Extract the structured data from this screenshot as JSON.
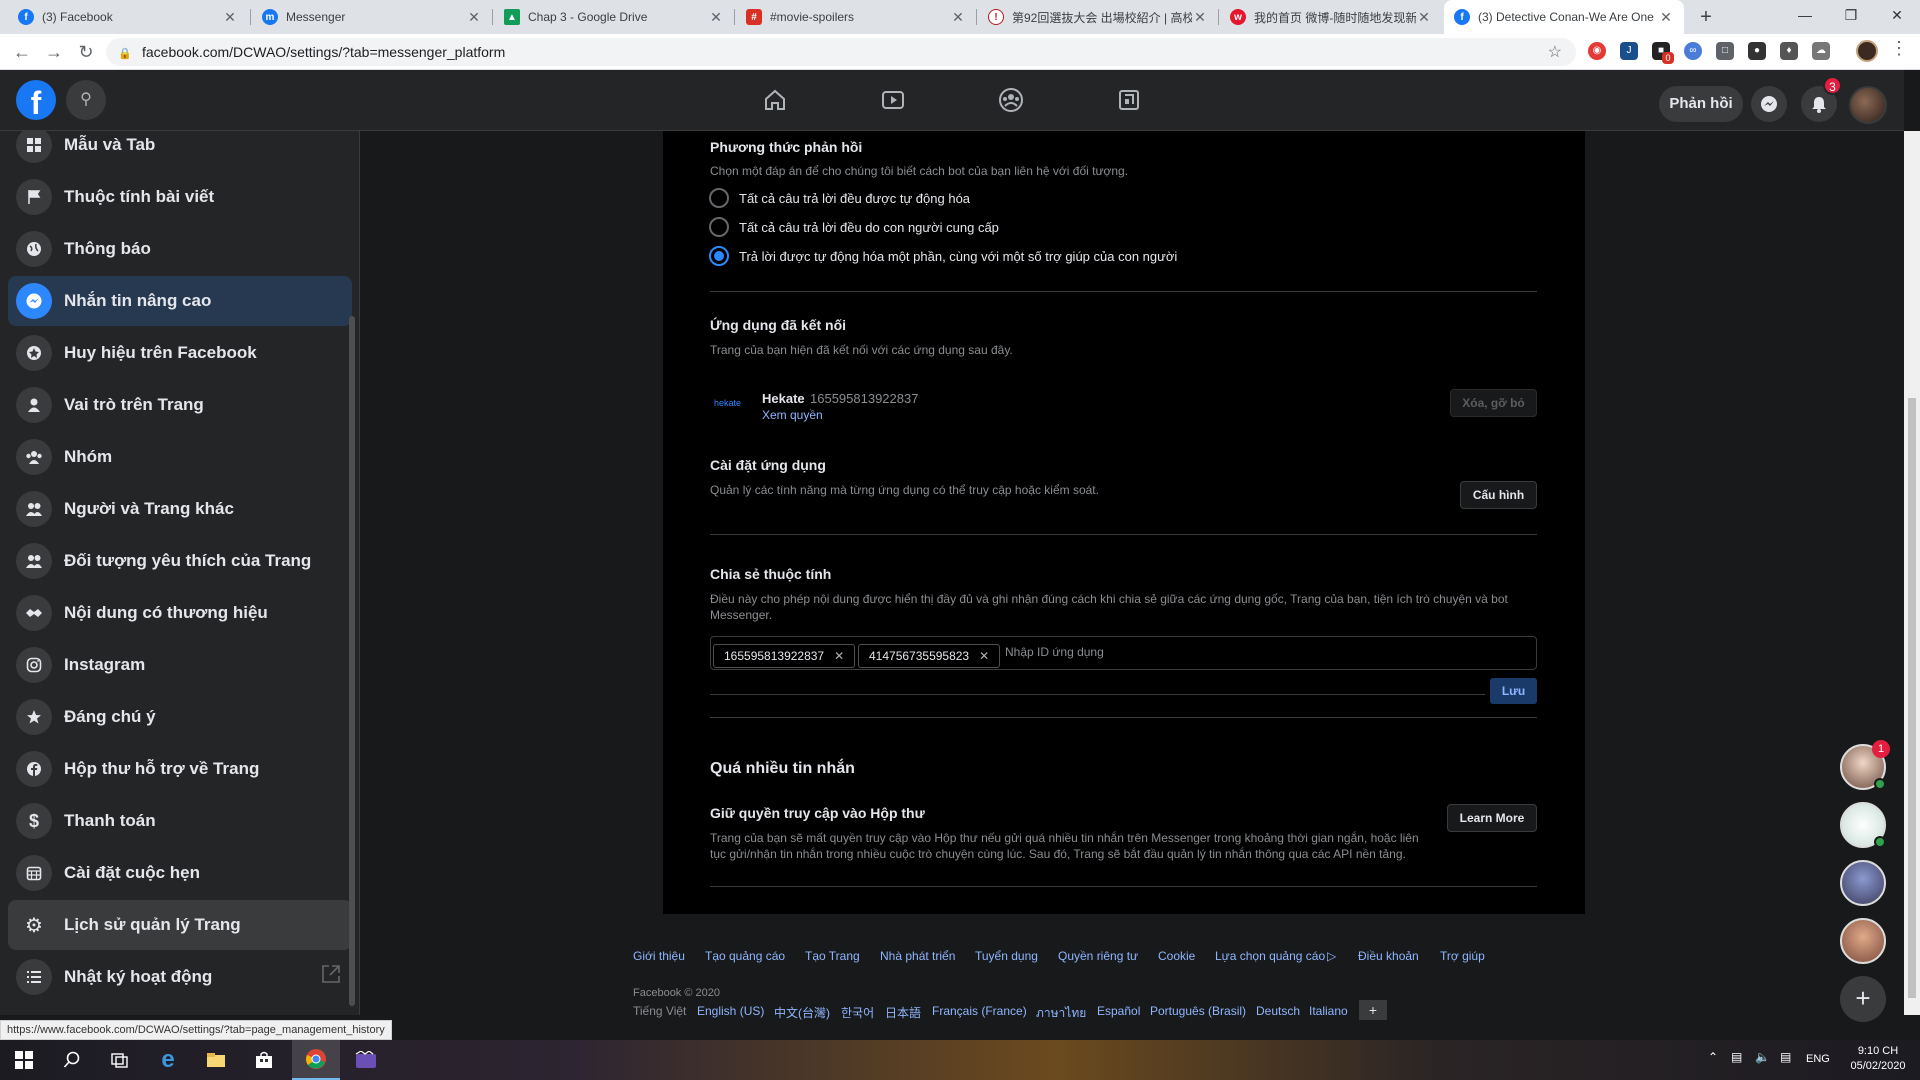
{
  "browser": {
    "tabs": [
      {
        "label": "(3) Facebook",
        "icon": "facebook-icon",
        "color": "#1877f2"
      },
      {
        "label": "Messenger",
        "icon": "messenger-icon",
        "color": "#1877f2"
      },
      {
        "label": "Chap 3 - Google Drive",
        "icon": "google-drive-icon",
        "color": "#0f9d58"
      },
      {
        "label": "#movie-spoilers",
        "icon": "discord-icon",
        "color": "#d93025"
      },
      {
        "label": "第92回選抜大会 出場校紹介 | 高校",
        "icon": "site-icon",
        "color": "#b71c1c"
      },
      {
        "label": "我的首页 微博-随时随地发现新鲜",
        "icon": "weibo-icon",
        "color": "#e6162d"
      },
      {
        "label": "(3) Detective Conan-We Are One",
        "icon": "facebook-icon",
        "color": "#1877f2"
      }
    ],
    "url": "facebook.com/DCWAO/settings/?tab=messenger_platform",
    "ext_badge": "0"
  },
  "header": {
    "feedback_label": "Phản hồi",
    "notification_count": "3"
  },
  "sidebar": {
    "items": [
      {
        "label": "Mẫu và Tab",
        "icon": "grid-icon"
      },
      {
        "label": "Thuộc tính bài viết",
        "icon": "flag-icon"
      },
      {
        "label": "Thông báo",
        "icon": "globe-icon"
      },
      {
        "label": "Nhắn tin nâng cao",
        "icon": "messenger-icon"
      },
      {
        "label": "Huy hiệu trên Facebook",
        "icon": "badge-icon"
      },
      {
        "label": "Vai trò trên Trang",
        "icon": "person-icon"
      },
      {
        "label": "Nhóm",
        "icon": "group-icon"
      },
      {
        "label": "Người và Trang khác",
        "icon": "people-icon"
      },
      {
        "label": "Đối tượng yêu thích của Trang",
        "icon": "people-icon"
      },
      {
        "label": "Nội dung có thương hiệu",
        "icon": "handshake-icon"
      },
      {
        "label": "Instagram",
        "icon": "instagram-icon"
      },
      {
        "label": "Đáng chú ý",
        "icon": "star-icon"
      },
      {
        "label": "Hộp thư hỗ trợ về Trang",
        "icon": "facebook-icon"
      },
      {
        "label": "Thanh toán",
        "icon": "dollar-icon"
      },
      {
        "label": "Cài đặt cuộc hẹn",
        "icon": "calendar-icon"
      },
      {
        "label": "Lịch sử quản lý Trang",
        "icon": "gear-icon"
      },
      {
        "label": "Nhật ký hoạt động",
        "icon": "list-icon"
      }
    ]
  },
  "response": {
    "title": "Phương thức phản hồi",
    "subtitle": "Chọn một đáp án để cho chúng tôi biết cách bot của bạn liên hệ với đối tượng.",
    "options": [
      "Tất cả câu trả lời đều được tự động hóa",
      "Tất cả câu trả lời đều do con người cung cấp",
      "Trả lời được tự động hóa một phần, cùng với một số trợ giúp của con người"
    ],
    "selected": "Trả lời được tự động hóa một phần, cùng với một số trợ giúp của con người"
  },
  "connected_apps": {
    "title": "Ứng dụng đã kết nối",
    "subtitle": "Trang của bạn hiện đã kết nối với các ứng dụng sau đây.",
    "app_logo": "hekate",
    "app_name": "Hekate",
    "app_id": "165595813922837",
    "view_permissions": "Xem quyền",
    "remove_label": "Xóa, gỡ bỏ"
  },
  "app_settings": {
    "title": "Cài đặt ứng dụng",
    "subtitle": "Quản lý các tính năng mà từng ứng dụng có thể truy cập hoặc kiểm soát.",
    "configure_label": "Cấu hình"
  },
  "share_properties": {
    "title": "Chia sẻ thuộc tính",
    "subtitle": "Điều này cho phép nội dung được hiển thị đầy đủ và ghi nhận đúng cách khi chia sẻ giữa các ứng dụng gốc, Trang của bạn, tiện ích trò chuyện và bot Messenger.",
    "chips": [
      "165595813922837",
      "414756735595823"
    ],
    "input_placeholder": "Nhập ID ứng dụng",
    "save_label": "Lưu"
  },
  "too_many": {
    "title": "Quá nhiều tin nhắn",
    "subtitle_title": "Giữ quyền truy cập vào Hộp thư",
    "desc": "Trang của bạn sẽ mất quyền truy cập vào Hộp thư nếu gửi quá nhiều tin nhắn trên Messenger trong khoảng thời gian ngắn, hoặc liên tục gửi/nhận tin nhắn trong nhiều cuộc trò chuyện cùng lúc. Sau đó, Trang sẽ bắt đầu quản lý tin nhắn thông qua các API nền tảng.",
    "learn_more": "Learn More"
  },
  "footer": {
    "links": [
      "Giới thiệu",
      "Tạo quảng cáo",
      "Tạo Trang",
      "Nhà phát triển",
      "Tuyển dụng",
      "Quyền riêng tư",
      "Cookie",
      "Lựa chọn quảng cáo",
      "Điều khoản",
      "Trợ giúp"
    ],
    "copyright": "Facebook © 2020",
    "current_language": "Tiếng Việt",
    "languages": [
      "English (US)",
      "中文(台灣)",
      "한국어",
      "日本語",
      "Français (France)",
      "ภาษาไทย",
      "Español",
      "Português (Brasil)",
      "Deutsch",
      "Italiano"
    ]
  },
  "chat": {
    "badge": "1"
  },
  "status_url": "https://www.facebook.com/DCWAO/settings/?tab=page_management_history",
  "taskbar": {
    "lang": "ENG",
    "time": "9:10 CH",
    "date": "05/02/2020"
  }
}
